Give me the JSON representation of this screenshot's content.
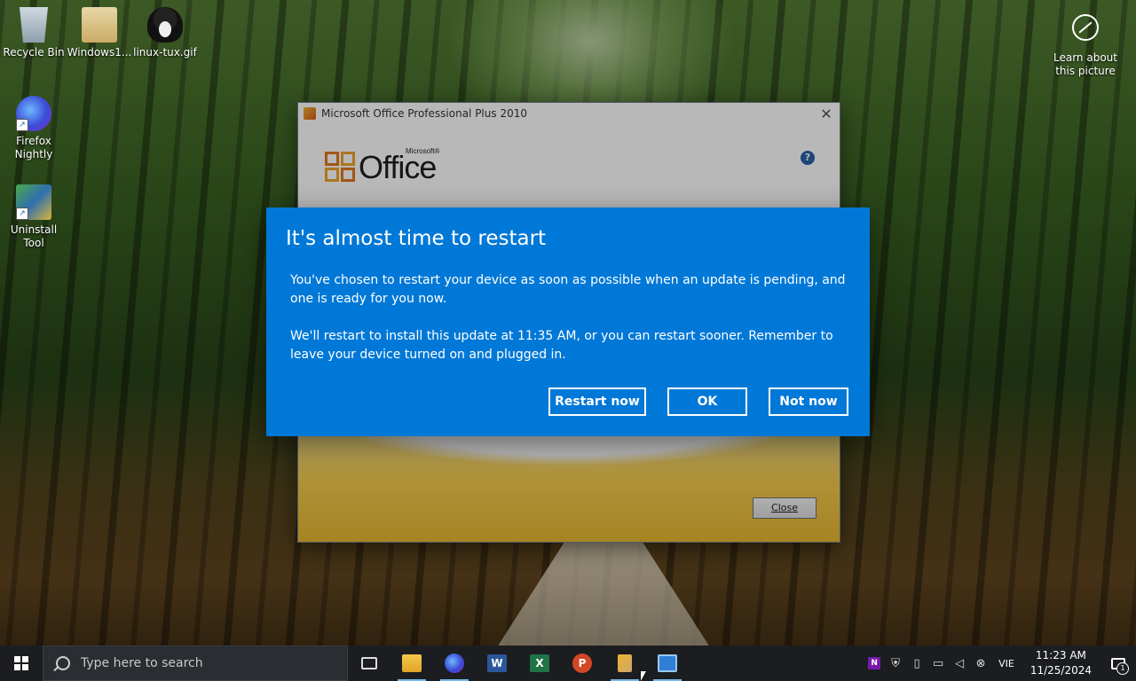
{
  "desktop": {
    "icons": [
      {
        "label": "Recycle Bin"
      },
      {
        "label": "Windows1..."
      },
      {
        "label": "linux-tux.gif"
      },
      {
        "label": "Firefox Nightly"
      },
      {
        "label": "Uninstall Tool"
      }
    ],
    "learn_about": "Learn about this picture"
  },
  "office_window": {
    "title": "Microsoft Office Professional Plus 2010",
    "logo_text": "Office",
    "logo_super": "Microsoft®",
    "help_glyph": "?",
    "close_button": "Close"
  },
  "restart_dialog": {
    "title": "It's almost time to restart",
    "paragraph1": "You've chosen to restart your device as soon as possible when an update is pending, and one is ready for you now.",
    "paragraph2": "We'll restart to install this update at 11:35 AM, or you can restart sooner. Remember to leave your device turned on and plugged in.",
    "buttons": {
      "restart_now": "Restart now",
      "ok": "OK",
      "not_now": "Not now"
    },
    "accent": "#0078d7"
  },
  "taskbar": {
    "search_placeholder": "Type here to search",
    "apps": [
      {
        "icon": "task-view-icon"
      },
      {
        "icon": "file-explorer-icon"
      },
      {
        "icon": "firefox-icon"
      },
      {
        "icon": "word-icon",
        "glyph": "W"
      },
      {
        "icon": "excel-icon",
        "glyph": "X"
      },
      {
        "icon": "powerpoint-icon",
        "glyph": "P"
      },
      {
        "icon": "office-setup-icon"
      },
      {
        "icon": "window-icon"
      }
    ],
    "tray": {
      "onenote_glyph": "N",
      "language": "VIE",
      "time": "11:23 AM",
      "date": "11/25/2024",
      "notification_count": "1"
    }
  }
}
